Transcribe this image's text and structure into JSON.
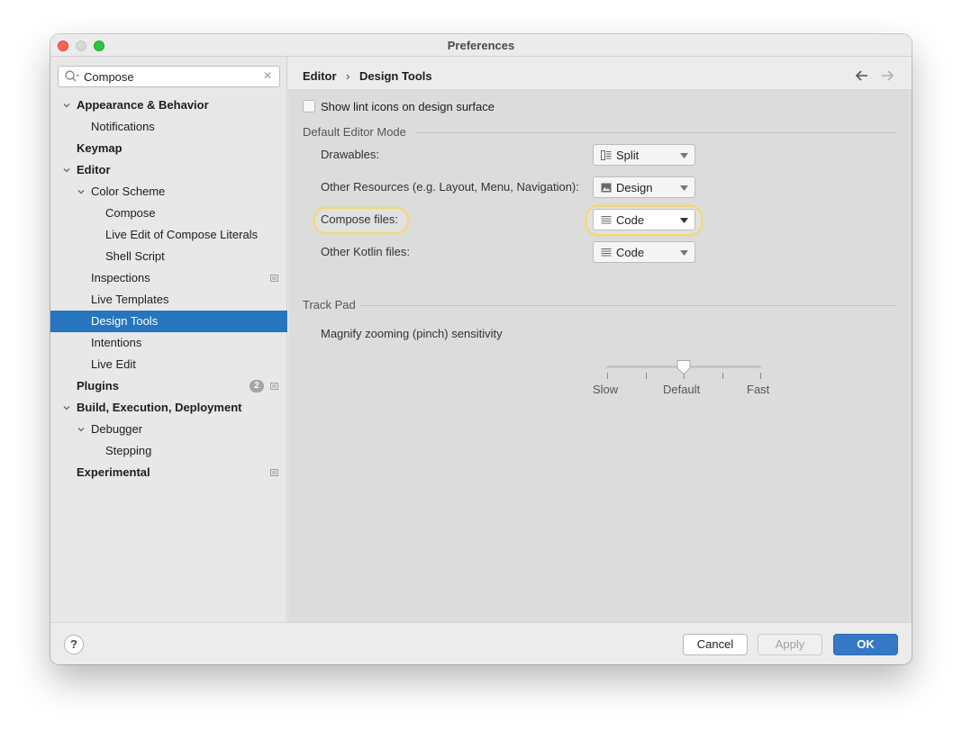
{
  "window": {
    "title": "Preferences"
  },
  "search": {
    "value": "Compose",
    "placeholder": ""
  },
  "tree": [
    {
      "label": "Appearance & Behavior",
      "level": 0,
      "bold": true,
      "expanded": true
    },
    {
      "label": "Notifications",
      "level": 1
    },
    {
      "label": "Keymap",
      "level": 0,
      "bold": true
    },
    {
      "label": "Editor",
      "level": 0,
      "bold": true,
      "expanded": true
    },
    {
      "label": "Color Scheme",
      "level": 1,
      "expanded": true
    },
    {
      "label": "Compose",
      "level": 2
    },
    {
      "label": "Live Edit of Compose Literals",
      "level": 2
    },
    {
      "label": "Shell Script",
      "level": 2
    },
    {
      "label": "Inspections",
      "level": 1,
      "project_icon": true
    },
    {
      "label": "Live Templates",
      "level": 1
    },
    {
      "label": "Design Tools",
      "level": 1,
      "selected": true
    },
    {
      "label": "Intentions",
      "level": 1
    },
    {
      "label": "Live Edit",
      "level": 1
    },
    {
      "label": "Plugins",
      "level": 0,
      "bold": true,
      "badge": "2",
      "project_icon": true
    },
    {
      "label": "Build, Execution, Deployment",
      "level": 0,
      "bold": true,
      "expanded": true
    },
    {
      "label": "Debugger",
      "level": 1,
      "expanded": true
    },
    {
      "label": "Stepping",
      "level": 2
    },
    {
      "label": "Experimental",
      "level": 0,
      "bold": true,
      "project_icon": true
    }
  ],
  "breadcrumb": {
    "parent": "Editor",
    "separator": "›",
    "current": "Design Tools"
  },
  "lint_checkbox": {
    "label": "Show lint icons on design surface",
    "checked": false
  },
  "editor_mode": {
    "title": "Default Editor Mode",
    "rows": [
      {
        "label": "Drawables:",
        "value": "Split",
        "icon": "split-icon"
      },
      {
        "label": "Other Resources (e.g. Layout, Menu, Navigation):",
        "value": "Design",
        "icon": "design-icon"
      },
      {
        "label": "Compose files:",
        "value": "Code",
        "icon": "code-icon",
        "highlighted": true
      },
      {
        "label": "Other Kotlin files:",
        "value": "Code",
        "icon": "code-icon"
      }
    ]
  },
  "trackpad": {
    "title": "Track Pad",
    "label": "Magnify zooming (pinch) sensitivity",
    "ticks": [
      "Slow",
      "Default",
      "Fast"
    ],
    "value_fraction": 0.5
  },
  "footer": {
    "help": "?",
    "cancel": "Cancel",
    "apply": "Apply",
    "ok": "OK"
  },
  "colors": {
    "selection": "#2675bf",
    "ok_button": "#3478c6",
    "highlight_ring": "#f1d87a"
  }
}
